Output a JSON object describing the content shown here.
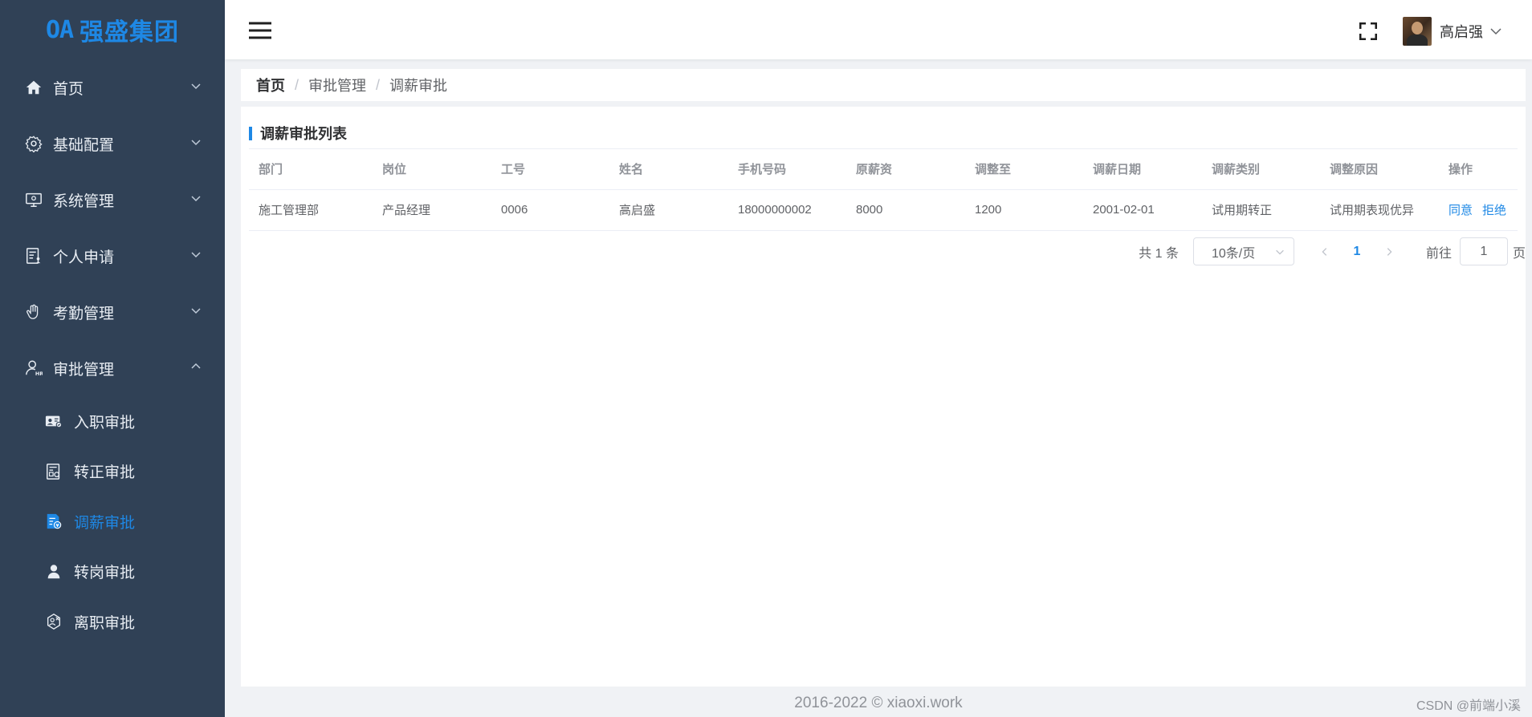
{
  "logo": {
    "mark": "OA",
    "name": "强盛集团"
  },
  "sidebar": {
    "items": [
      {
        "label": "首页",
        "icon": "home-icon"
      },
      {
        "label": "基础配置",
        "icon": "gear-icon"
      },
      {
        "label": "系统管理",
        "icon": "monitor-icon"
      },
      {
        "label": "个人申请",
        "icon": "document-user-icon"
      },
      {
        "label": "考勤管理",
        "icon": "hand-icon"
      },
      {
        "label": "审批管理",
        "icon": "user-hr-icon",
        "expanded": true
      }
    ],
    "subitems": [
      {
        "label": "入职审批",
        "icon": "id-card-icon"
      },
      {
        "label": "转正审批",
        "icon": "certificate-icon"
      },
      {
        "label": "调薪审批",
        "icon": "salary-doc-icon",
        "active": true
      },
      {
        "label": "转岗审批",
        "icon": "person-icon"
      },
      {
        "label": "离职审批",
        "icon": "leave-icon"
      }
    ]
  },
  "header": {
    "user_name": "高启强"
  },
  "breadcrumb": {
    "items": [
      "首页",
      "审批管理",
      "调薪审批"
    ],
    "separator": "/"
  },
  "card": {
    "title": "调薪审批列表"
  },
  "table": {
    "columns": [
      "部门",
      "岗位",
      "工号",
      "姓名",
      "手机号码",
      "原薪资",
      "调整至",
      "调薪日期",
      "调薪类别",
      "调整原因",
      "操作"
    ],
    "rows": [
      {
        "cells": [
          "施工管理部",
          "产品经理",
          "0006",
          "高启盛",
          "18000000002",
          "8000",
          "1200",
          "2001-02-01",
          "试用期转正",
          "试用期表现优异"
        ],
        "actions": [
          "同意",
          "拒绝"
        ]
      }
    ]
  },
  "pagination": {
    "total_text": "共 1 条",
    "page_size": "10条/页",
    "current_page": "1",
    "goto_label": "前往",
    "goto_value": "1",
    "page_suffix": "页"
  },
  "footer": {
    "text": "2016-2022 © xiaoxi.work",
    "watermark": "CSDN @前端小溪"
  },
  "colors": {
    "sidebar_bg": "#304156",
    "accent": "#1e88e5"
  }
}
